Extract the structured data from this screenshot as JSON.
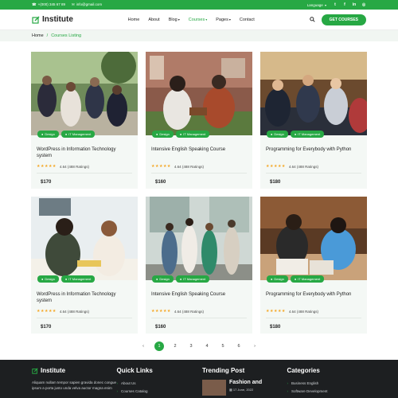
{
  "topbar": {
    "phone": "+(000) 345 67 89",
    "email": "info@gmail.com",
    "language": "Language",
    "socials": [
      "twitter",
      "facebook",
      "linkedin",
      "instagram"
    ]
  },
  "nav": {
    "logo": "Institute",
    "menu": [
      {
        "label": "Home",
        "dropdown": false
      },
      {
        "label": "About",
        "dropdown": false
      },
      {
        "label": "Blog",
        "dropdown": true
      },
      {
        "label": "Courses",
        "dropdown": true
      },
      {
        "label": "Pages",
        "dropdown": true
      },
      {
        "label": "Contact",
        "dropdown": false
      }
    ],
    "cta": "GET COURSES"
  },
  "breadcrumb": {
    "home": "Home",
    "sep": "/",
    "current": "Courses Listing"
  },
  "colors": {
    "accent": "#27a844",
    "dark": "#1d1f21",
    "star": "#f5a623"
  },
  "courses": [
    {
      "tag1": "Design",
      "tag2": "IT Management",
      "title": "WordPress in Information Technology system",
      "rating": "4.64 (488 Ratings)",
      "price": "$170"
    },
    {
      "tag1": "Design",
      "tag2": "IT Management",
      "title": "Intensive English Speaking Course",
      "rating": "4.64 (488 Ratings)",
      "price": "$160"
    },
    {
      "tag1": "Design",
      "tag2": "IT Management",
      "title": "Programming for Everybody with Python",
      "rating": "4.64 (488 Ratings)",
      "price": "$180"
    },
    {
      "tag1": "Design",
      "tag2": "IT Management",
      "title": "WordPress in Information Technology system",
      "rating": "4.64 (488 Ratings)",
      "price": "$170"
    },
    {
      "tag1": "Design",
      "tag2": "IT Management",
      "title": "Intensive English Speaking Course",
      "rating": "4.64 (488 Ratings)",
      "price": "$160"
    },
    {
      "tag1": "Design",
      "tag2": "IT Management",
      "title": "Programming for Everybody with Python",
      "rating": "4.64 (488 Ratings)",
      "price": "$180"
    }
  ],
  "stars": "★★★★★",
  "pagination": {
    "prev": "‹",
    "pages": [
      "1",
      "2",
      "3",
      "4",
      "5",
      "6"
    ],
    "next": "›",
    "current": "1"
  },
  "footer": {
    "brand": "Institute",
    "about": "Aliquam nullam tempor sapien gravida donec congue ipsum a porta justo unda velva auctor magna enim",
    "quick_title": "Quick Links",
    "quick_links": [
      "About Us",
      "Courses Catalog"
    ],
    "trending_title": "Trending Post",
    "trending_post_title": "Fashion and",
    "trending_post_date": "17 June, 2022",
    "categories_title": "Categories",
    "categories": [
      "Business English",
      "Software Development"
    ]
  }
}
